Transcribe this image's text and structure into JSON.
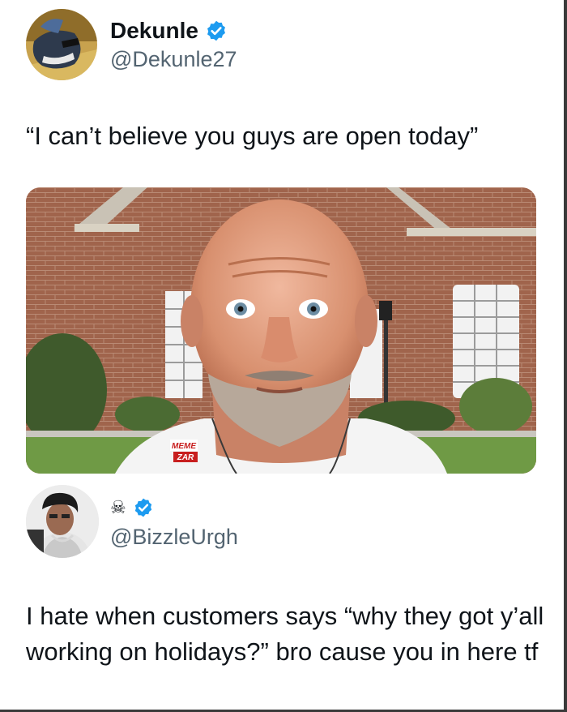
{
  "tweet": {
    "author": {
      "display_name": "Dekunle",
      "handle": "@Dekunle27",
      "verified": true
    },
    "text": "“I can’t believe you guys are open today”",
    "media": {
      "watermark_line1": "MEME",
      "watermark_line2": "ZAR"
    }
  },
  "reply": {
    "author": {
      "display_name": "☠",
      "handle": "@BizzleUrgh",
      "verified": true
    },
    "text": "I hate when customers says “why they got y’all working on holidays?” bro cause you in here tf"
  },
  "colors": {
    "verified_blue": "#1d9bf0",
    "handle_gray": "#536471",
    "text": "#0f1419"
  }
}
